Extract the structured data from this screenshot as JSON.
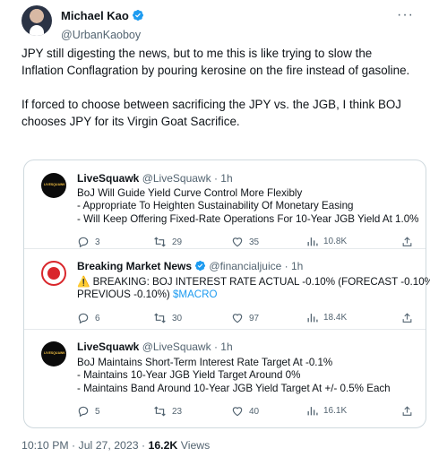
{
  "author": {
    "name": "Michael Kao",
    "handle": "@UrbanKaoboy"
  },
  "tweet": {
    "paragraph1": "JPY still digesting the news, but to me this is like trying to slow the Inflation Conflagration by pouring kerosine on the fire instead of gasoline.",
    "paragraph2": "If forced to choose between sacrificing the JPY vs. the JGB, I think BOJ chooses JPY for its Virgin Goat Sacrifice."
  },
  "quotes": [
    {
      "name": "LiveSquawk",
      "handle": "@LiveSquawk",
      "time": "1h",
      "avatar_label": "LIVESQUAWK",
      "lines": [
        "BoJ Will Guide Yield Curve Control More Flexibly",
        "- Appropriate To Heighten Sustainability Of Monetary Easing",
        "- Will Keep Offering Fixed-Rate Operations For 10-Year JGB Yield At 1.0%"
      ],
      "replies": "3",
      "retweets": "29",
      "likes": "35",
      "views": "10.8K"
    },
    {
      "name": "Breaking Market News",
      "handle": "@financialjuice",
      "time": "1h",
      "line1": "⚠️ BREAKING: BOJ INTEREST RATE ACTUAL -0.10% (FORECAST -0.10%,",
      "line2_text": "PREVIOUS -0.10%)",
      "cashtag": "$MACRO",
      "replies": "6",
      "retweets": "30",
      "likes": "97",
      "views": "18.4K"
    },
    {
      "name": "LiveSquawk",
      "handle": "@LiveSquawk",
      "time": "1h",
      "avatar_label": "LIVESQUAWK",
      "lines": [
        "BoJ Maintains Short-Term Interest Rate Target At -0.1%",
        "- Maintains 10-Year JGB Yield Target Around 0%",
        "- Maintains Band Around 10-Year JGB Yield Target At +/- 0.5% Each"
      ],
      "replies": "5",
      "retweets": "23",
      "likes": "40",
      "views": "16.1K"
    }
  ],
  "footer": {
    "timestamp": "10:10 PM · Jul 27, 2023 ·",
    "views": "16.2K",
    "views_label": "Views"
  },
  "colors": {
    "verified": "#1d9bf0",
    "text": "#0f1419",
    "muted": "#536471",
    "link": "#1d9bf0",
    "border": "#cfd9de"
  }
}
